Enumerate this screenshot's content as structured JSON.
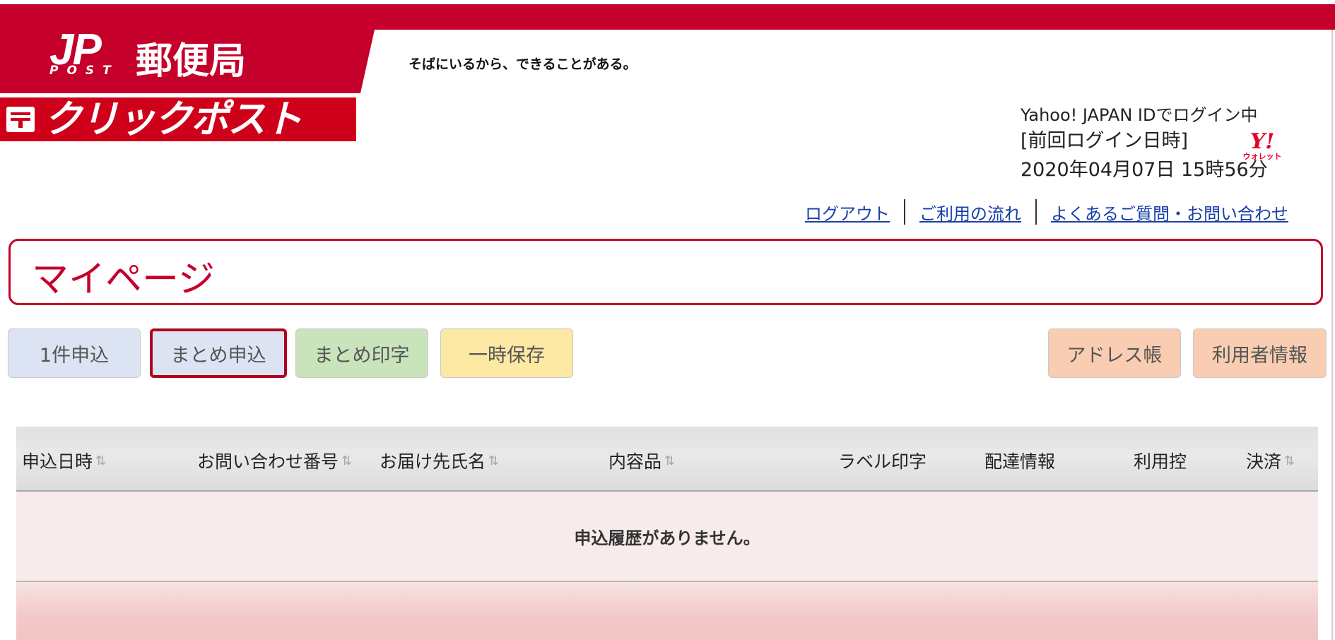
{
  "header": {
    "jp_logo": "JP",
    "post_text": "POST",
    "brand": "郵便局",
    "tagline": "そばにいるから、できることがある。",
    "service_title": "クリックポスト"
  },
  "login": {
    "line1": "Yahoo! JAPAN IDでログイン中",
    "line2": "[前回ログイン日時]",
    "line3": "2020年04月07日 15時56分",
    "wallet_mark": "Y!",
    "wallet_text": "ウォレット"
  },
  "links": {
    "logout": "ログアウト",
    "flow": "ご利用の流れ",
    "faq": "よくあるご質問・お問い合わせ"
  },
  "page_title": "マイページ",
  "buttons": {
    "single": "1件申込",
    "bulk": "まとめ申込",
    "bulk_print": "まとめ印字",
    "temp_save": "一時保存",
    "address_book": "アドレス帳",
    "user_info": "利用者情報"
  },
  "table": {
    "headers": {
      "date": "申込日時",
      "inquiry_no": "お問い合わせ番号",
      "recipient": "お届け先氏名",
      "contents": "内容品",
      "label": "ラベル印字",
      "delivery": "配達情報",
      "receipt": "利用控",
      "payment": "決済"
    },
    "empty_message": "申込履歴がありません。"
  },
  "colors": {
    "brand_red": "#c4002b",
    "link_blue": "#1a3fa8"
  }
}
